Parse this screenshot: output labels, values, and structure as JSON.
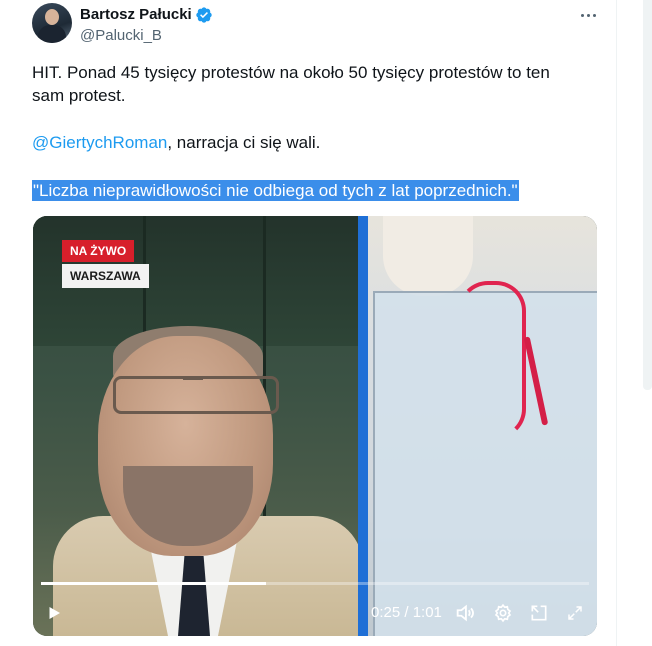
{
  "author": {
    "display_name": "Bartosz Pałucki",
    "handle": "@Palucki_B",
    "verified_icon": "verified-badge-icon",
    "avatar_icon": "avatar-icon"
  },
  "tweet": {
    "line1": "HIT. Ponad 45 tysięcy protestów na około 50 tysięcy protestów to ten",
    "line1b": "sam protest.",
    "mention": "@GiertychRoman",
    "mention_rest": ", narracja ci się wali.",
    "quote_highlighted": "\"Liczba nieprawidłowości nie odbiega od tych z lat poprzednich.\""
  },
  "video": {
    "badge_live": "NA ŻYWO",
    "badge_location": "WARSZAWA",
    "time_display": "0:25 / 1:01",
    "progress_fraction": 0.41,
    "controls": [
      "play-icon",
      "volume-icon",
      "settings-gear-icon",
      "picture-in-picture-icon",
      "fullscreen-icon"
    ]
  },
  "colors": {
    "accent_link": "#1d9bf0",
    "highlight": "#3b8eea",
    "live_red": "#d71f2b"
  }
}
